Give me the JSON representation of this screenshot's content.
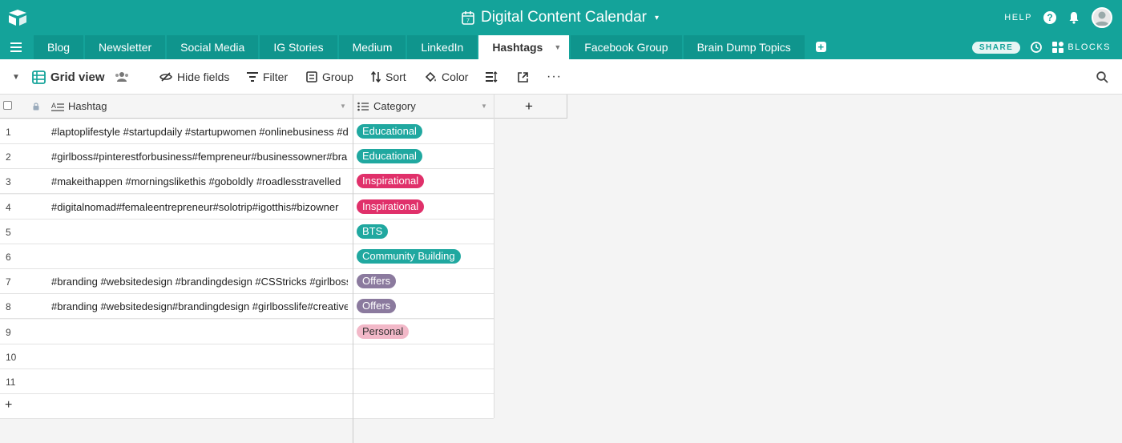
{
  "header": {
    "title": "Digital Content Calendar",
    "help_label": "HELP"
  },
  "tabs": [
    {
      "label": "Blog"
    },
    {
      "label": "Newsletter"
    },
    {
      "label": "Social Media"
    },
    {
      "label": "IG Stories"
    },
    {
      "label": "Medium"
    },
    {
      "label": "LinkedIn"
    },
    {
      "label": "Hashtags",
      "active": true
    },
    {
      "label": "Facebook Group"
    },
    {
      "label": "Brain Dump Topics"
    }
  ],
  "tab_actions": {
    "share_label": "SHARE",
    "blocks_label": "BLOCKS"
  },
  "toolbar": {
    "view_name": "Grid view",
    "hide_fields": "Hide fields",
    "filter": "Filter",
    "group": "Group",
    "sort": "Sort",
    "color": "Color"
  },
  "columns": {
    "hashtag": "Hashtag",
    "category": "Category",
    "add": "+"
  },
  "colors": {
    "brand": "#14a39a",
    "educational": "#20a8a0",
    "inspirational": "#e0306a",
    "bts": "#20a8a0",
    "community": "#20a8a0",
    "offers": "#8b7a9e",
    "personal": "#f2b8c8"
  },
  "rows": [
    {
      "num": "1",
      "hashtag": "#laptoplifestyle #startupdaily #startupwomen #onlinebusiness #digitalnomad",
      "category": "Educational",
      "color": "#20a8a0",
      "text_color": "#fff"
    },
    {
      "num": "2",
      "hashtag": "#girlboss#pinterestforbusiness#fempreneur#businessowner#branding",
      "category": "Educational",
      "color": "#20a8a0",
      "text_color": "#fff"
    },
    {
      "num": "3",
      "hashtag": "#makeithappen #morningslikethis #goboldly #roadlesstravelled",
      "category": "Inspirational",
      "color": "#e0306a",
      "text_color": "#fff"
    },
    {
      "num": "4",
      "hashtag": "#digitalnomad#femaleentrepreneur#solotrip#igotthis#bizowner",
      "category": "Inspirational",
      "color": "#e0306a",
      "text_color": "#fff"
    },
    {
      "num": "5",
      "hashtag": "",
      "category": "BTS",
      "color": "#20a8a0",
      "text_color": "#fff"
    },
    {
      "num": "6",
      "hashtag": "",
      "category": "Community Building",
      "color": "#20a8a0",
      "text_color": "#fff"
    },
    {
      "num": "7",
      "hashtag": "#branding #websitedesign #brandingdesign #CSStricks #girlbosslife",
      "category": "Offers",
      "color": "#8b7a9e",
      "text_color": "#fff"
    },
    {
      "num": "8",
      "hashtag": "#branding #websitedesign#brandingdesign #girlbosslife#creativebiz",
      "category": "Offers",
      "color": "#8b7a9e",
      "text_color": "#fff"
    },
    {
      "num": "9",
      "hashtag": "",
      "category": "Personal",
      "color": "#f2b8c8",
      "text_color": "#333"
    },
    {
      "num": "10",
      "hashtag": "",
      "category": "",
      "color": "",
      "text_color": ""
    },
    {
      "num": "11",
      "hashtag": "",
      "category": "",
      "color": "",
      "text_color": ""
    }
  ],
  "add_row_label": "+"
}
